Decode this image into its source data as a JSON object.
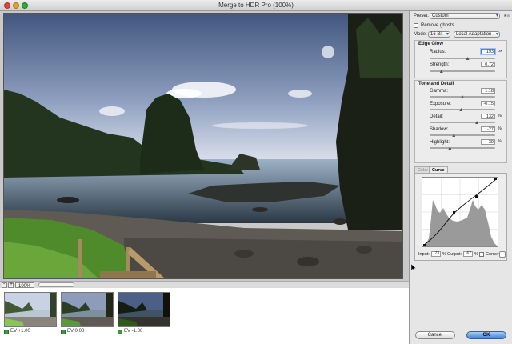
{
  "window": {
    "title": "Merge to HDR Pro (100%)"
  },
  "preset": {
    "label": "Preset:",
    "value": "Custom"
  },
  "remove_ghosts": {
    "label": "Remove ghosts"
  },
  "mode": {
    "label": "Mode:",
    "bit_depth": "16 Bit",
    "method": "Local Adaptation"
  },
  "edge_glow": {
    "title": "Edge Glow",
    "radius": {
      "label": "Radius:",
      "value": "193",
      "unit": "px",
      "fraction": 0.58
    },
    "strength": {
      "label": "Strength:",
      "value": "0.72",
      "fraction": 0.18
    }
  },
  "tone_detail": {
    "title": "Tone and Detail",
    "gamma": {
      "label": "Gamma:",
      "value": "1.18",
      "fraction": 0.5
    },
    "exposure": {
      "label": "Exposure:",
      "value": "-0.15",
      "fraction": 0.48
    },
    "detail": {
      "label": "Detail:",
      "value": "132",
      "unit": "%",
      "fraction": 0.72
    },
    "shadow": {
      "label": "Shadow:",
      "value": "-27",
      "unit": "%",
      "fraction": 0.37
    },
    "highlight": {
      "label": "Highlight:",
      "value": "-39",
      "unit": "%",
      "fraction": 0.31
    }
  },
  "curve_tabs": {
    "color": "Color",
    "curve": "Curve"
  },
  "curve": {
    "input_label": "Input:",
    "input_value": "73",
    "input_unit": "%",
    "output_label": "Output:",
    "output_value": "67",
    "output_unit": "%",
    "corner_label": "Corner"
  },
  "status": {
    "zoom": "100%"
  },
  "thumbnails": [
    {
      "label": "EV +1.00"
    },
    {
      "label": "EV 0.00"
    },
    {
      "label": "EV -1.00"
    }
  ],
  "buttons": {
    "cancel": "Cancel",
    "ok": "OK"
  },
  "colors": {
    "accent": "#3d7fd8",
    "checked": "#3a9a3a"
  }
}
